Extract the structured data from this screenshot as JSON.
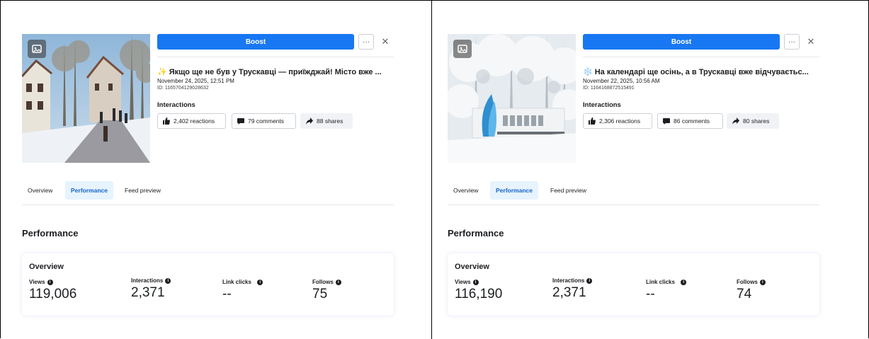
{
  "panels": [
    {
      "boost_label": "Boost",
      "more_label": "···",
      "close_label": "✕",
      "post": {
        "emoji": "✨",
        "title": "Якщо ще не був у Трускавці — приїжджай! Місто вже ...",
        "date": "November 24, 2025, 12:51 PM",
        "id": "ID: 1165704129028632"
      },
      "interactions_label": "Interactions",
      "chips": {
        "reactions": "2,402 reactions",
        "comments": "79 comments",
        "shares": "88 shares"
      },
      "tabs": [
        "Overview",
        "Performance",
        "Feed preview"
      ],
      "active_tab": "Performance",
      "performance_title": "Performance",
      "overview_title": "Overview",
      "metrics": [
        {
          "label": "Views",
          "value": "119,006"
        },
        {
          "label": "Interactions",
          "value": "2,371"
        },
        {
          "label": "Link clicks",
          "value": "--"
        },
        {
          "label": "Follows",
          "value": "75"
        }
      ]
    },
    {
      "boost_label": "Boost",
      "more_label": "···",
      "close_label": "✕",
      "post": {
        "emoji": "❄️",
        "title": "На календарі ще осінь, а в Трускавці вже відчуваєтьс...",
        "date": "November 22, 2025, 10:56 AM",
        "id": "ID: 1164168872515491"
      },
      "interactions_label": "Interactions",
      "chips": {
        "reactions": "2,306 reactions",
        "comments": "86 comments",
        "shares": "80 shares"
      },
      "tabs": [
        "Overview",
        "Performance",
        "Feed preview"
      ],
      "active_tab": "Performance",
      "performance_title": "Performance",
      "overview_title": "Overview",
      "metrics": [
        {
          "label": "Views",
          "value": "116,190"
        },
        {
          "label": "Interactions",
          "value": "2,371"
        },
        {
          "label": "Link clicks",
          "value": "--"
        },
        {
          "label": "Follows",
          "value": "74"
        }
      ]
    }
  ],
  "colors": {
    "accent": "#1877f2",
    "active_tab_bg": "#e7f3ff",
    "active_tab_text": "#1464c8"
  }
}
